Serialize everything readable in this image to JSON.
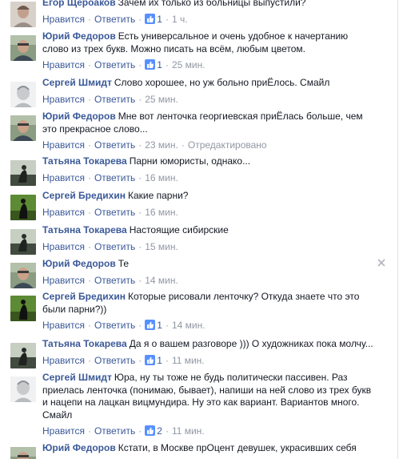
{
  "labels": {
    "like": "Нравится",
    "reply": "Ответить",
    "sep": "·"
  },
  "comments": [
    {
      "author": "Егор Щероаков",
      "text": "Зачем их только из больницы выпустили?",
      "likes": "1",
      "time": "1 ч.",
      "avatar": "egor"
    },
    {
      "author": "Юрий Федоров",
      "text": "Есть универсальное и очень удобное к начертанию слово из трех букв. Можно писать на всём, любым цветом.",
      "likes": "1",
      "time": "25 мин.",
      "avatar": "yuri"
    },
    {
      "author": "Сергей Шмидт",
      "text": "Слово хорошее, но уж больно приЁлось. Смайл",
      "likes": "",
      "time": "25 мин.",
      "avatar": "sergsh"
    },
    {
      "author": "Юрий Федоров",
      "text": "Мне вот ленточка георгиевская приЁлась больше, чем это прекрасное слово...",
      "likes": "",
      "time": "23 мин.",
      "extra": "Отредактировано",
      "avatar": "yuri"
    },
    {
      "author": "Татьяна Токарева",
      "text": "Парни юмористы, однако...",
      "likes": "",
      "time": "16 мин.",
      "avatar": "tatiana"
    },
    {
      "author": "Сергей Бредихин",
      "text": "Какие парни?",
      "likes": "",
      "time": "16 мин.",
      "avatar": "bredikhin"
    },
    {
      "author": "Татьяна Токарева",
      "text": "Настоящие сибирские",
      "likes": "",
      "time": "15 мин.",
      "avatar": "tatiana"
    },
    {
      "author": "Юрий Федоров",
      "text": "Те",
      "likes": "",
      "time": "14 мин.",
      "avatar": "yuri"
    },
    {
      "author": "Сергей Бредихин",
      "text": "Которые рисовали ленточку? Откуда знаете что это были парни?))",
      "likes": "1",
      "time": "14 мин.",
      "avatar": "bredikhin"
    },
    {
      "author": "Татьяна Токарева",
      "text": "Да я о вашем разговоре ))) О художниках пока молчу...",
      "likes": "1",
      "time": "11 мин.",
      "avatar": "tatiana"
    },
    {
      "author": "Сергей Шмидт",
      "text": "Юра, ну ты тоже не будь политически пассивен. Раз приелась ленточка (понимаю, бывает), напиши на ней слово из трех букв и нацепи на лацкан вицмундира. Ну это как вариант. Вариантов много. Смайл",
      "likes": "2",
      "time": "11 мин.",
      "avatar": "sergsh"
    },
    {
      "author": "Юрий Федоров",
      "text": "Кстати, в Москве прОцент девушек, украсивших себя",
      "likes": "",
      "time": "",
      "avatar": "yuri"
    }
  ],
  "colors": {
    "link": "#3b5998",
    "meta": "#9197a3",
    "text": "#141823"
  },
  "icons": {
    "like": "thumbs-up-icon",
    "close": "close-icon"
  }
}
